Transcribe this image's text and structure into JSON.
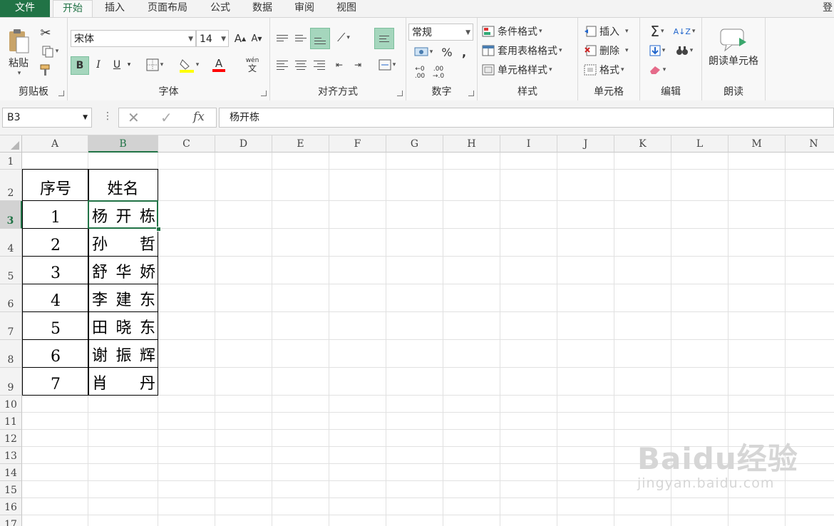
{
  "tabs": [
    "文件",
    "开始",
    "插入",
    "页面布局",
    "公式",
    "数据",
    "审阅",
    "视图"
  ],
  "right_corner_text": "登",
  "clipboard": {
    "paste": "粘贴",
    "label": "剪贴板"
  },
  "font": {
    "name": "宋体",
    "size": "14",
    "bold": "B",
    "italic": "I",
    "underline": "U",
    "grow": "A",
    "shrink": "A",
    "color_glyph": "A",
    "phonetic_top": "wén",
    "phonetic_bottom": "文",
    "label": "字体"
  },
  "alignment": {
    "label": "对齐方式"
  },
  "number": {
    "format": "常规",
    "percent": "%",
    "comma": ",",
    "inc_decimal_top": "←0",
    "inc_decimal_bottom": ".00",
    "dec_decimal_top": ".00",
    "dec_decimal_bottom": "→.0",
    "label": "数字"
  },
  "styles": {
    "conditional": "条件格式",
    "table": "套用表格格式",
    "cell": "单元格样式",
    "label": "样式"
  },
  "cells": {
    "insert": "插入",
    "delete": "删除",
    "format": "格式",
    "label": "单元格"
  },
  "editing": {
    "sum": "Σ",
    "label": "编辑"
  },
  "read": {
    "button": "朗读单元格",
    "label": "朗读"
  },
  "formula_bar": {
    "name_box": "B3",
    "fx": "fx",
    "value": "杨开栋"
  },
  "columns": [
    "A",
    "B",
    "C",
    "D",
    "E",
    "F",
    "G",
    "H",
    "I",
    "J",
    "K",
    "L",
    "M",
    "N"
  ],
  "rows": [
    "1",
    "2",
    "3",
    "4",
    "5",
    "6",
    "7",
    "8",
    "9",
    "10",
    "11",
    "12",
    "13",
    "14",
    "15",
    "16",
    "17"
  ],
  "table": {
    "header": [
      "序号",
      "姓名"
    ],
    "rows": [
      {
        "no": "1",
        "name": [
          "杨",
          "开",
          "栋"
        ]
      },
      {
        "no": "2",
        "name": [
          "孙",
          "",
          "哲"
        ]
      },
      {
        "no": "3",
        "name": [
          "舒",
          "华",
          "娇"
        ]
      },
      {
        "no": "4",
        "name": [
          "李",
          "建",
          "东"
        ]
      },
      {
        "no": "5",
        "name": [
          "田",
          "晓",
          "东"
        ]
      },
      {
        "no": "6",
        "name": [
          "谢",
          "振",
          "辉"
        ]
      },
      {
        "no": "7",
        "name": [
          "肖",
          "",
          "丹"
        ]
      }
    ]
  },
  "watermark": {
    "line1": "Baidu经验",
    "line2": "jingyan.baidu.com"
  },
  "colors": {
    "accent": "#217346",
    "highlight_yellow": "#ffff00",
    "font_red": "#ff0000"
  }
}
